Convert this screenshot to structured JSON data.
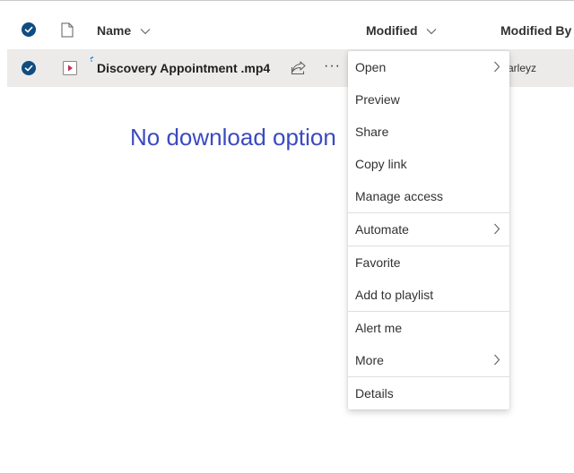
{
  "header": {
    "columns": {
      "name": "Name",
      "modified": "Modified",
      "modified_by": "Modified By"
    }
  },
  "row": {
    "file_name": "Discovery Appointment .mp4",
    "modified_by_partial": "arleyz"
  },
  "annotation": "No download option",
  "menu": {
    "items": [
      {
        "label": "Open"
      },
      {
        "label": "Preview"
      },
      {
        "label": "Share"
      },
      {
        "label": "Copy link"
      },
      {
        "label": "Manage access"
      },
      {
        "label": "Automate"
      },
      {
        "label": "Favorite"
      },
      {
        "label": "Add to playlist"
      },
      {
        "label": "Alert me"
      },
      {
        "label": "More"
      },
      {
        "label": "Details"
      }
    ]
  },
  "colors": {
    "accent": "#0f4c81",
    "selected_row": "#edebe9",
    "annotation": "#3b4ac0",
    "video_icon": "#c4314b"
  },
  "icons": [
    "checkmark-icon",
    "document-icon",
    "chevron-down-icon",
    "video-file-icon",
    "share-icon",
    "more-icon",
    "chevron-right-icon",
    "loading-icon"
  ]
}
